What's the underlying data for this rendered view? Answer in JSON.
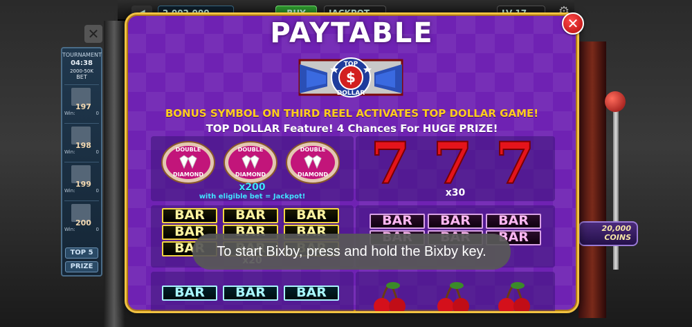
{
  "background": {
    "coins_value": "2,002,000",
    "buy_label": "BUY",
    "jackpot_label": "JACKPOT",
    "level_label": "LV 17",
    "tournament": {
      "title": "TOURNAMENT",
      "timer": "04:38",
      "range": "2000-50K",
      "bet": "BET",
      "ranks": [
        {
          "rank": "197",
          "win_label": "Win:",
          "win_value": "0"
        },
        {
          "rank": "198",
          "win_label": "Win:",
          "win_value": "0"
        },
        {
          "rank": "199",
          "win_label": "Win:",
          "win_value": "0"
        },
        {
          "rank": "200",
          "win_label": "Win:",
          "win_value": "0"
        }
      ],
      "top5_label": "TOP 5",
      "prize_label": "PRIZE"
    },
    "coin_badge": {
      "value": "20,000",
      "unit": "COINS"
    }
  },
  "paytable": {
    "title": "PAYTABLE",
    "logo": {
      "top": "TOP",
      "symbol": "$",
      "bottom": "DOLLAR"
    },
    "bonus_text": "BONUS SYMBOL ON THIRD REEL ACTIVATES TOP DOLLAR GAME!",
    "feature_text": "TOP DOLLAR Feature! 4 Chances For HUGE PRIZE!",
    "entries": [
      {
        "symbol": "double-diamond",
        "symbol_text": [
          "DOUBLE",
          "DIAMOND"
        ],
        "payout": "x200",
        "note": "with eligible bet = Jackpot!"
      },
      {
        "symbol": "seven",
        "symbol_text": "7",
        "payout": "x30"
      },
      {
        "symbol": "triple-bar",
        "symbol_text": "BAR",
        "payout": "x20"
      },
      {
        "symbol": "double-bar",
        "symbol_text": "BAR"
      },
      {
        "symbol": "single-bar",
        "symbol_text": "BAR"
      },
      {
        "symbol": "cherry"
      }
    ]
  },
  "toast": {
    "message": "To start Bixby, press and hold the Bixby key."
  },
  "colors": {
    "modal_bg": "#6f22b3",
    "modal_border": "#f2c341",
    "bonus_text": "#ffcc1f",
    "multiplier_cyan": "#41e2ff",
    "close_red": "#d41616"
  }
}
